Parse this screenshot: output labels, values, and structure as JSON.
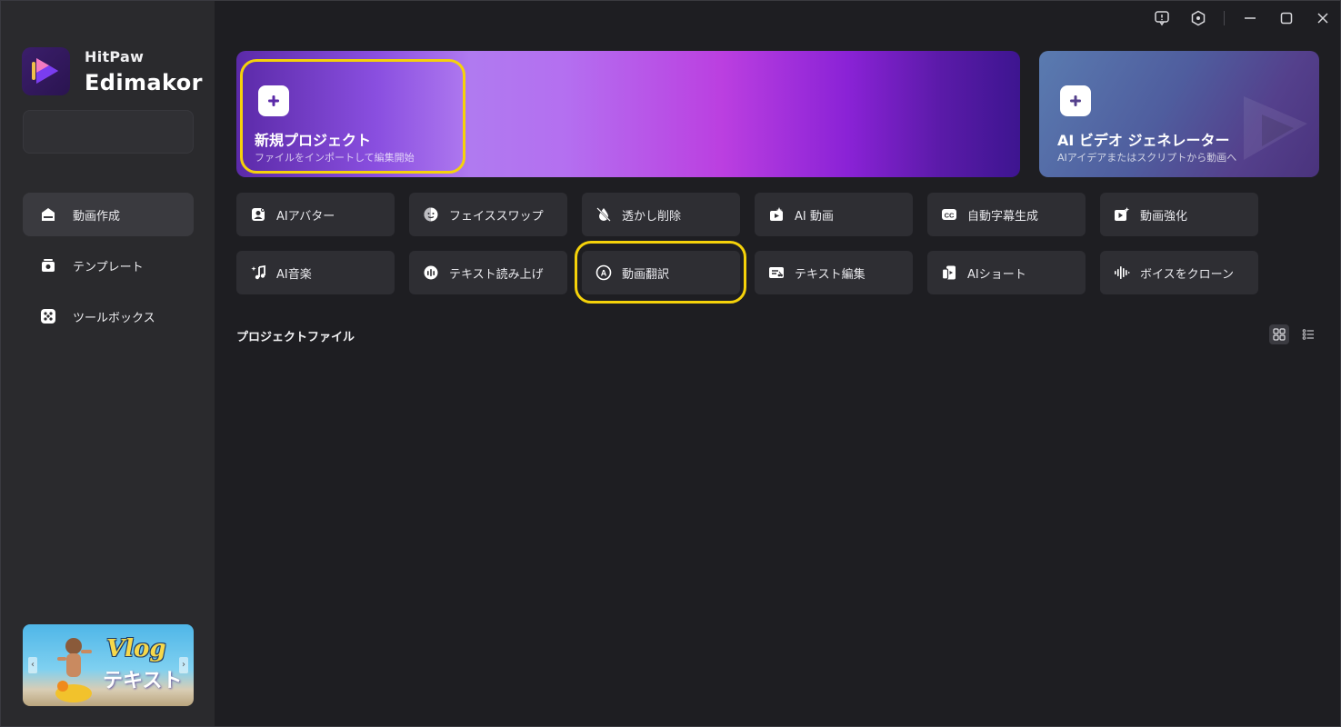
{
  "brand": {
    "line1": "HitPaw",
    "line2": "Edimakor"
  },
  "sidebar": {
    "items": [
      {
        "label": "動画作成",
        "icon": "home-icon",
        "active": true
      },
      {
        "label": "テンプレート",
        "icon": "template-icon",
        "active": false
      },
      {
        "label": "ツールボックス",
        "icon": "toolbox-icon",
        "active": false
      }
    ],
    "promo": {
      "title": "Vlog",
      "subtitle": "テキスト"
    }
  },
  "titlebar": {
    "buttons": [
      "feedback-icon",
      "settings-icon",
      "minimize-icon",
      "maximize-icon",
      "close-icon"
    ]
  },
  "banners": {
    "new_project": {
      "title": "新規プロジェクト",
      "subtitle": "ファイルをインポートして編集開始"
    },
    "ai_video": {
      "title": "AI ビデオ ジェネレーター",
      "subtitle": "AIアイデアまたはスクリプトから動画へ"
    }
  },
  "tools": {
    "row1": [
      {
        "label": "AIアバター",
        "icon": "avatar-icon"
      },
      {
        "label": "フェイススワップ",
        "icon": "face-swap-icon"
      },
      {
        "label": "透かし削除",
        "icon": "watermark-remove-icon"
      },
      {
        "label": "AI 動画",
        "icon": "ai-video-icon"
      },
      {
        "label": "自動字幕生成",
        "icon": "cc-icon"
      },
      {
        "label": "動画強化",
        "icon": "video-enhance-icon"
      }
    ],
    "row2": [
      {
        "label": "AI音楽",
        "icon": "ai-music-icon"
      },
      {
        "label": "テキスト読み上げ",
        "icon": "tts-icon"
      },
      {
        "label": "動画翻訳",
        "icon": "translate-icon"
      },
      {
        "label": "テキスト編集",
        "icon": "text-edit-icon"
      },
      {
        "label": "AIショート",
        "icon": "ai-short-icon"
      },
      {
        "label": "ボイスをクローン",
        "icon": "voice-clone-icon"
      }
    ]
  },
  "projects": {
    "title": "プロジェクトファイル",
    "view_modes": [
      "grid-view-icon",
      "list-view-icon"
    ],
    "active_view": "grid"
  },
  "colors": {
    "highlight": "#f5d20a",
    "sidebar_bg": "#2a2a2d",
    "main_bg": "#1e1e22",
    "tool_bg": "#2e2e33"
  }
}
